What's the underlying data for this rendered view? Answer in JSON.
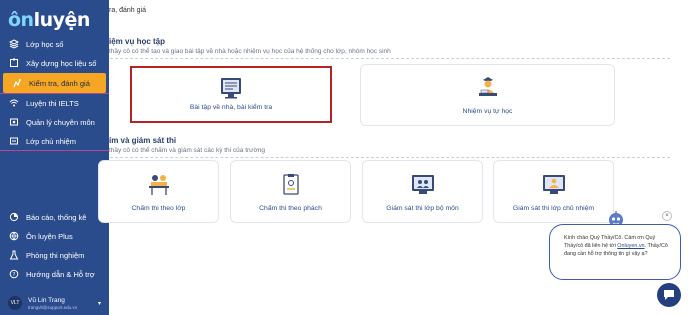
{
  "app": {
    "logo_prefix": "ôn",
    "logo_suffix": "luyện"
  },
  "sidebar": {
    "items": [
      {
        "label": "Lớp học số",
        "icon": "layers-icon"
      },
      {
        "label": "Xây dựng học liệu số",
        "icon": "puzzle-icon"
      },
      {
        "label": "Kiểm tra, đánh giá",
        "icon": "exam-icon",
        "active": true
      },
      {
        "label": "Luyện thi IELTS",
        "icon": "wifi-icon"
      },
      {
        "label": "Quản lý chuyên môn",
        "icon": "folder-icon"
      },
      {
        "label": "Lớp chủ nhiệm",
        "icon": "class-icon"
      },
      {
        "label": "Báo cáo, thống kê",
        "icon": "chart-icon"
      },
      {
        "label": "Ôn luyện Plus",
        "icon": "globe-icon"
      },
      {
        "label": "Phòng thi nghiệm",
        "icon": "flask-icon"
      },
      {
        "label": "Hướng dẫn & Hỗ trợ",
        "icon": "help-icon"
      }
    ],
    "user": {
      "initials": "VLT",
      "name": "Vũ Lin Trang",
      "email": "trangvlt@support.edu.vn"
    }
  },
  "breadcrumb": "ra, đánh giá",
  "section1": {
    "title": "iệm vụ học tập",
    "subtitle": "thầy cô có thể tạo và giao bài tập về nhà hoặc nhiệm vụ học của hệ thống cho lớp, nhóm học sinh",
    "cards": [
      {
        "label": "Bài tập về nhà, bài kiểm tra",
        "icon": "homework-icon"
      },
      {
        "label": "Nhiệm vụ tự học",
        "icon": "self-study-icon"
      }
    ]
  },
  "section2": {
    "title": "ím và giám sát thi",
    "subtitle": "thầy cô có thể chấm và giám sát các kỳ thi của trường",
    "cards": [
      {
        "label": "Chấm thi theo lớp",
        "icon": "grade-class-icon"
      },
      {
        "label": "Chấm thi theo phách",
        "icon": "grade-code-icon"
      },
      {
        "label": "Giám sát thi lớp bộ môn",
        "icon": "monitor-subject-icon"
      },
      {
        "label": "Giám sát thi lớp chủ nhiệm",
        "icon": "monitor-homeroom-icon"
      }
    ]
  },
  "chat": {
    "message_part1": "Kính chào Quý Thầy/Cô. Cảm ơn Quý Thầy/cô đã liên hệ tới ",
    "link": "Onluyen.vn",
    "message_part2": ". Thầy/Cô đang cần hỗ trợ thông tin gì vậy ạ?",
    "close_label": "×"
  }
}
